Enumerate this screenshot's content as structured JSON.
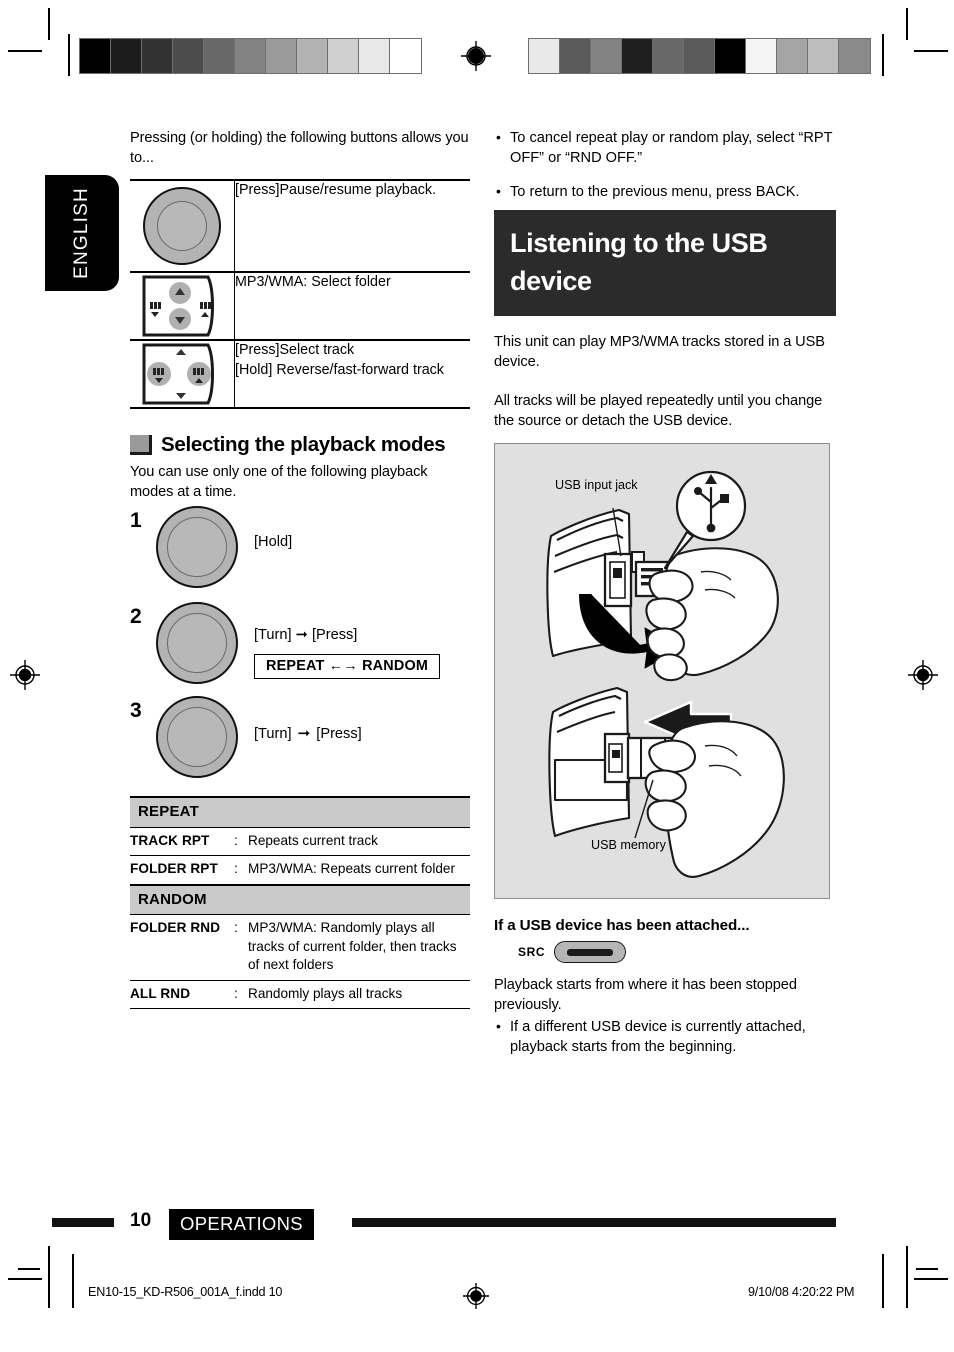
{
  "page": {
    "language_tab": "ENGLISH",
    "page_number": "10",
    "chapter": "OPERATIONS"
  },
  "left": {
    "intro": "Pressing (or holding) the following buttons allows you to...",
    "button_table": [
      {
        "icon": "rotary-knob-icon",
        "text_lines": [
          "[Press]Pause/resume playback."
        ]
      },
      {
        "icon": "four-way-pad-updown-icon",
        "text_lines": [
          "MP3/WMA: Select folder"
        ]
      },
      {
        "icon": "four-way-pad-leftright-icon",
        "text_lines": [
          "[Press]Select track",
          "[Hold] Reverse/fast-forward track"
        ]
      }
    ],
    "section": {
      "heading": "Selecting the playback modes",
      "intro": "You can use only one of the following playback modes at a time.",
      "steps": [
        {
          "num": "1",
          "action": "[Hold]",
          "arrow": "",
          "action2": "",
          "chip": ""
        },
        {
          "num": "2",
          "action": "[Turn]",
          "arrow": "➞",
          "action2": "[Press]",
          "chip": "REPEAT ←→ RANDOM"
        },
        {
          "num": "3",
          "action": "[Turn]",
          "arrow": "➞",
          "action2": "[Press]",
          "chip": ""
        }
      ]
    },
    "mode_table": [
      {
        "type": "group",
        "label": "REPEAT"
      },
      {
        "type": "item",
        "name": "TRACK RPT",
        "colon": ":",
        "desc": "Repeats current track"
      },
      {
        "type": "item",
        "name": "FOLDER RPT",
        "colon": ":",
        "desc": "MP3/WMA: Repeats current folder"
      },
      {
        "type": "group",
        "label": "RANDOM"
      },
      {
        "type": "item",
        "name": "FOLDER RND",
        "colon": ":",
        "desc": "MP3/WMA: Randomly plays all tracks of current folder, then tracks of next folders"
      },
      {
        "type": "item",
        "name": "ALL RND",
        "colon": ":",
        "desc": "Randomly plays all tracks"
      }
    ]
  },
  "right": {
    "bullets": [
      "To cancel repeat play or random play, select “RPT OFF” or “RND OFF.”",
      "To return to the previous menu, press BACK."
    ],
    "banner_title": "Listening to the USB device",
    "paragraph1": "This unit can play MP3/WMA tracks stored in a USB device.",
    "paragraph2": "All tracks will be played repeatedly until you change the source or detach the USB device.",
    "illustration": {
      "label_top": "USB input jack",
      "label_bottom": "USB memory",
      "usb_symbol": "usb-trident-icon"
    },
    "attached_heading": "If a USB device has been attached...",
    "src_label": "SRC",
    "paragraph3": "Playback starts from where it has been stopped previously.",
    "bullet_last": "If a different USB device is currently attached, playback starts from the beginning."
  },
  "print_marks": {
    "color_bar_left": [
      "#000000",
      "#1c1c1c",
      "#323232",
      "#4c4c4c",
      "#686868",
      "#838383",
      "#9b9b9b",
      "#b3b3b3",
      "#cfcfcf",
      "#e9e9e9",
      "#ffffff"
    ],
    "color_bar_right": [
      "#e9e9e9",
      "#5a5a5a",
      "#838383",
      "#1f1f1f",
      "#686868",
      "#5a5a5a",
      "#000000",
      "#f5f5f5",
      "#a5a5a5",
      "#bdbdbd",
      "#8a8a8a"
    ],
    "registration_icon": "registration-target-icon"
  },
  "footer": {
    "file_name": "EN10-15_KD-R506_001A_f.indd   10",
    "timestamp": "9/10/08   4:20:22 PM"
  }
}
